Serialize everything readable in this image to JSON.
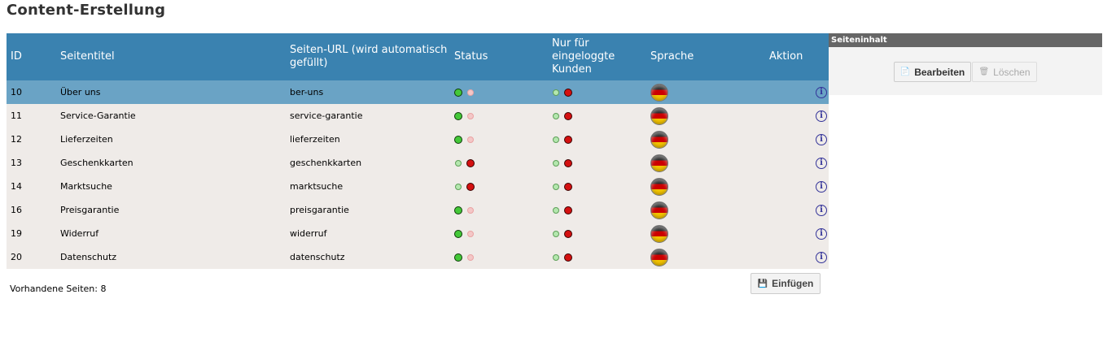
{
  "title": "Content-Erstellung",
  "columns": {
    "id": "ID",
    "title": "Seitentitel",
    "url": "Seiten-URL (wird automatisch gefüllt)",
    "status": "Status",
    "logged_in": "Nur für eingeloggte Kunden",
    "language": "Sprache",
    "action": "Aktion"
  },
  "rows": [
    {
      "id": "10",
      "title": "Über uns",
      "url": "ber-uns",
      "status_active": true,
      "logged_in_only": false,
      "language": "de",
      "selected": true
    },
    {
      "id": "11",
      "title": "Service-Garantie",
      "url": "service-garantie",
      "status_active": true,
      "logged_in_only": false,
      "language": "de",
      "selected": false
    },
    {
      "id": "12",
      "title": "Lieferzeiten",
      "url": "lieferzeiten",
      "status_active": true,
      "logged_in_only": false,
      "language": "de",
      "selected": false
    },
    {
      "id": "13",
      "title": "Geschenkkarten",
      "url": "geschenkkarten",
      "status_active": false,
      "logged_in_only": false,
      "language": "de",
      "selected": false
    },
    {
      "id": "14",
      "title": "Marktsuche",
      "url": "marktsuche",
      "status_active": false,
      "logged_in_only": false,
      "language": "de",
      "selected": false
    },
    {
      "id": "16",
      "title": "Preisgarantie",
      "url": "preisgarantie",
      "status_active": true,
      "logged_in_only": false,
      "language": "de",
      "selected": false
    },
    {
      "id": "19",
      "title": "Widerruf",
      "url": "widerruf",
      "status_active": true,
      "logged_in_only": false,
      "language": "de",
      "selected": false
    },
    {
      "id": "20",
      "title": "Datenschutz",
      "url": "datenschutz",
      "status_active": true,
      "logged_in_only": false,
      "language": "de",
      "selected": false
    }
  ],
  "footer": {
    "count_label": "Vorhandene Seiten: 8"
  },
  "buttons": {
    "insert": "Einfügen",
    "edit": "Bearbeiten",
    "delete": "Löschen"
  },
  "side_panel": {
    "header": "Seiteninhalt"
  },
  "icons": {
    "info": "info-icon",
    "flag": "german-flag-icon",
    "insert": "save-icon",
    "edit": "document-icon",
    "delete": "trash-icon"
  },
  "colors": {
    "header_bg": "#3a82b0",
    "selected_row": "#6aa3c5",
    "row_bg": "#efebe8",
    "panel_header": "#666666"
  }
}
